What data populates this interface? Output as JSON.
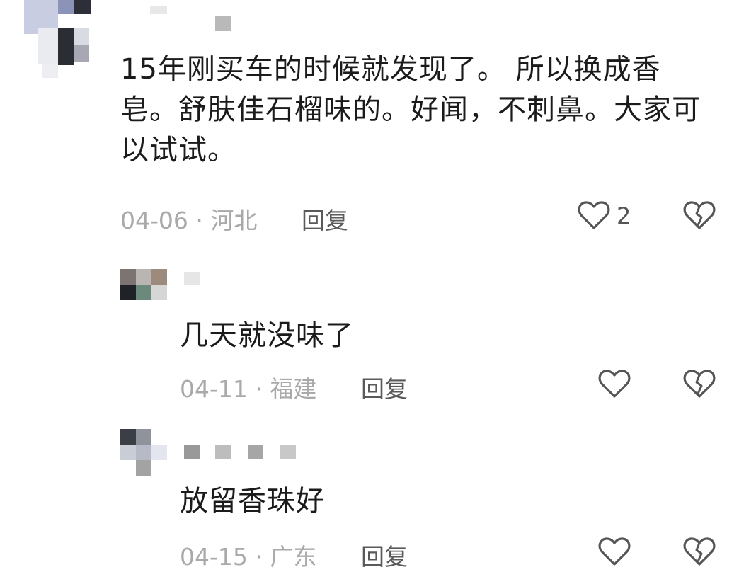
{
  "comments": [
    {
      "text": "15年刚买车的时候就发现了。 所以换成香皂。舒肤佳石榴味的。好闻，不刺鼻。大家可以试试。",
      "date_location": "04-06 · 河北",
      "reply_label": "回复",
      "like_count": "2",
      "icons": [
        "heart-icon",
        "broken-heart-icon"
      ]
    },
    {
      "text": "几天就没味了",
      "date_location": "04-11 · 福建",
      "reply_label": "回复",
      "icons": [
        "heart-icon",
        "broken-heart-icon"
      ]
    },
    {
      "text": "放留香珠好",
      "date_location": "04-15 · 广东",
      "reply_label": "回复",
      "icons": [
        "heart-icon",
        "broken-heart-icon"
      ]
    }
  ]
}
